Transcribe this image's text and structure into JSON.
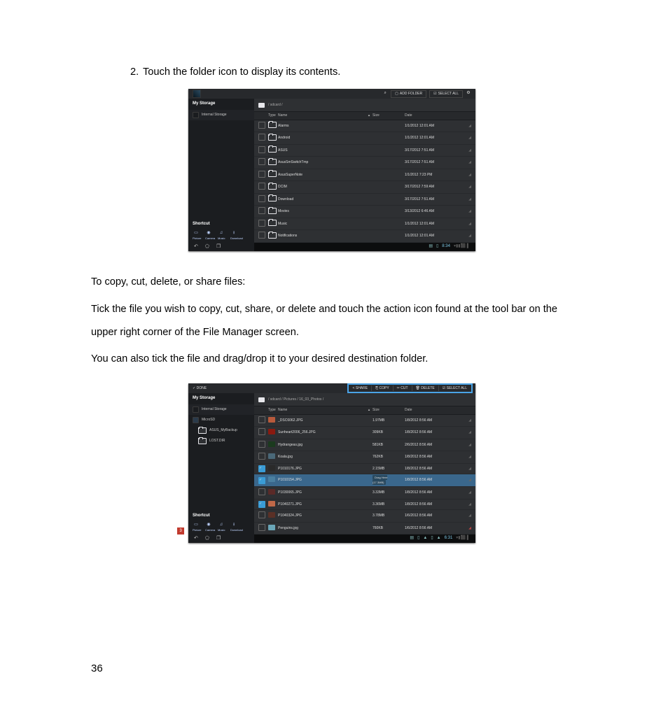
{
  "page_number": "36",
  "step": {
    "num": "2.",
    "text": "Touch the folder icon to display its contents."
  },
  "para1": "To copy, cut, delete, or share files:",
  "para2": "Tick the file you wish to copy, cut, share, or delete and touch the action icon found at the tool bar on the upper right corner of the File Manager screen.",
  "para3": "You can also tick the file and drag/drop it to your desired destination folder.",
  "sc1": {
    "topbar": {
      "add_folder": "ADD FOLDER",
      "select_all": "SELECT ALL"
    },
    "sidebar": {
      "title": "My Storage",
      "item1": "Internal Storage",
      "shortcut_title": "Shortcut",
      "shortcuts": [
        "Picture",
        "Camera",
        "Music",
        "Download"
      ]
    },
    "crumb": "/ sdcard /",
    "headers": {
      "type": "Type",
      "name": "Name",
      "size": "Size",
      "date": "Date"
    },
    "rows": [
      {
        "name": "Alarms",
        "date": "1/1/2012 12:01 AM"
      },
      {
        "name": "Android",
        "date": "1/1/2012 12:01 AM"
      },
      {
        "name": "ASUS",
        "date": "3/17/2012 7:51 AM"
      },
      {
        "name": "AsusSmSwitchTmp",
        "date": "3/17/2012 7:51 AM"
      },
      {
        "name": "AsusSuperNote",
        "date": "1/1/2012 7:23 PM"
      },
      {
        "name": "DCIM",
        "date": "3/17/2012 7:59 AM"
      },
      {
        "name": "Download",
        "date": "3/17/2012 7:51 AM"
      },
      {
        "name": "Movies",
        "date": "3/13/2012 6:46 AM"
      },
      {
        "name": "Music",
        "date": "1/1/2012 12:01 AM"
      },
      {
        "name": "Notifications",
        "date": "1/1/2012 12:01 AM"
      }
    ],
    "status_time": "8:34"
  },
  "sc2": {
    "topbar": {
      "done": "DONE",
      "share": "SHARE",
      "copy": "COPY",
      "cut": "CUT",
      "delete": "DELETE",
      "select_all": "SELECT ALL"
    },
    "sidebar": {
      "title": "My Storage",
      "item1": "Internal Storage",
      "item2": "MicroSD",
      "item3": "ASUS_MyBackup",
      "item4": "LOST.DIR",
      "shortcut_title": "Shortcut",
      "shortcuts": [
        "Picture",
        "Camera",
        "Music",
        "Download"
      ]
    },
    "crumb": "/ sdcard / Pictures / 16_03_Photos /",
    "headers": {
      "type": "Type",
      "name": "Name",
      "size": "Size",
      "date": "Date"
    },
    "rows": [
      {
        "ico": "#b85a3c",
        "name": "_DSC6062.JPG",
        "size": "1.97MB",
        "date": "1/8/2012 8:56 AM"
      },
      {
        "ico": "#8a1a10",
        "name": "Sunheart2006_256.JPG",
        "size": "309KB",
        "date": "1/8/2012 8:56 AM"
      },
      {
        "ico": "#1b3a1e",
        "name": "Hydrangeas.jpg",
        "size": "581KB",
        "date": "2/6/2012 8:56 AM"
      },
      {
        "ico": "#4a6878",
        "name": "Koala.jpg",
        "size": "762KB",
        "date": "1/8/2012 8:56 AM"
      },
      {
        "ico": "#2a2a2a",
        "chk": true,
        "name": "P1010176.JPG",
        "size": "2.15MB",
        "date": "1/8/2012 8:56 AM"
      },
      {
        "ico": "#4a7fa0",
        "chk": true,
        "sel": true,
        "name": "P1010154.JPG",
        "size": "Drag Here\\n(17.3MB)",
        "date": "1/8/2012 8:56 AM",
        "drag": true
      },
      {
        "ico": "#5a2a28",
        "name": "P1030065.JPG",
        "size": "3.33MB",
        "date": "1/8/2012 8:56 AM"
      },
      {
        "ico": "#c06848",
        "chk": true,
        "name": "P1040271.JPG",
        "size": "3.36MB",
        "date": "1/8/2012 8:56 AM"
      },
      {
        "ico": "#5a3026",
        "name": "P1040324.JPG",
        "size": "3.78MB",
        "date": "1/6/2012 8:56 AM"
      },
      {
        "ico": "#6aa6b8",
        "name": "Penguins.jpg",
        "size": "760KB",
        "date": "1/6/2012 8:56 AM"
      }
    ],
    "badge": "3",
    "status_time": "6:31"
  }
}
